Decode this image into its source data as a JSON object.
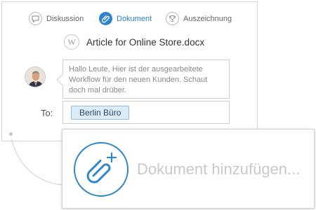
{
  "tabs": [
    {
      "label": "Diskussion",
      "icon": "chat-icon",
      "active": false
    },
    {
      "label": "Dokument",
      "icon": "paperclip-icon",
      "active": true
    },
    {
      "label": "Auszeichnung",
      "icon": "trophy-icon",
      "active": false
    }
  ],
  "document": {
    "icon": "word-document-icon",
    "icon_letter": "W",
    "filename": "Article for Online Store.docx"
  },
  "message": {
    "text": "Hallo Leute, Hier ist der ausgearbeitete Workflow für den neuen Kunden. Schaut doch mal drüber."
  },
  "recipient": {
    "label": "To:",
    "chip": "Berlin Büro"
  },
  "add_document": {
    "label": "Dokument hinzufügen...",
    "icon": "paperclip-plus-icon"
  },
  "colors": {
    "accent": "#2f84c7",
    "chip_bg": "#dcecf9",
    "chip_border": "#8cbde4",
    "border": "#d6d6d6",
    "muted_text": "#c9c9c9"
  }
}
